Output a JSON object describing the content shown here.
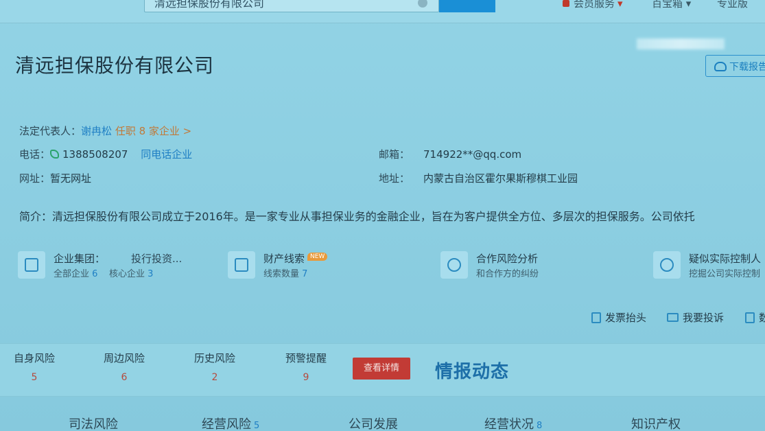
{
  "search": {
    "query": "清远担保股份有限公司"
  },
  "top_nav": {
    "member": "会员服务",
    "bao": "百宝箱",
    "pro": "专业版"
  },
  "download_label": "下载报告",
  "company": {
    "name": "清远担保股份有限公司",
    "legal_rep_label": "法定代表人：",
    "legal_rep_name": "谢冉松",
    "legal_rep_roles": "任职 8 家企业 >",
    "phone_label": "电话：",
    "phone": "1388508207",
    "same_phone_link": "同电话企业",
    "email_label": "邮箱：",
    "email": "714922**@qq.com",
    "website_label": "网址：",
    "website": "暂无网址",
    "address_label": "地址：",
    "address": "内蒙古自治区霍尔果斯穆棋工业园",
    "intro_label": "简介：",
    "intro": "清远担保股份有限公司成立于2016年。是一家专业从事担保业务的金融企业，旨在为客户提供全方位、多层次的担保服务。公司依托"
  },
  "features": [
    {
      "title": "企业集团：",
      "extra": "投行投资...",
      "sub1_label": "全部企业",
      "sub1_num": "6",
      "sub2_label": "核心企业",
      "sub2_num": "3",
      "icon": "building-icon"
    },
    {
      "title": "财产线索",
      "badge": "NEW",
      "sub_label": "线索数量",
      "sub_num": "7",
      "icon": "clue-icon"
    },
    {
      "title": "合作风险分析",
      "sub": "和合作方的纠纷",
      "icon": "shield-check-icon"
    },
    {
      "title": "疑似实际控制人",
      "sub": "挖掘公司实际控制",
      "icon": "controller-icon"
    }
  ],
  "actions": [
    {
      "label": "发票抬头",
      "icon": "invoice-icon"
    },
    {
      "label": "我要投诉",
      "icon": "mail-icon"
    },
    {
      "label": "数",
      "icon": "data-icon"
    }
  ],
  "risks": [
    {
      "label": "自身风险",
      "count": "5"
    },
    {
      "label": "周边风险",
      "count": "6"
    },
    {
      "label": "历史风险",
      "count": "2"
    },
    {
      "label": "预警提醒",
      "count": "9"
    }
  ],
  "detail_button": "查看详情",
  "intel_title": "情报动态",
  "bottom_tabs": [
    {
      "label": "司法风险",
      "count": ""
    },
    {
      "label": "经营风险",
      "count": "5"
    },
    {
      "label": "公司发展",
      "count": ""
    },
    {
      "label": "经营状况",
      "count": "8"
    },
    {
      "label": "知识产权",
      "count": ""
    }
  ]
}
